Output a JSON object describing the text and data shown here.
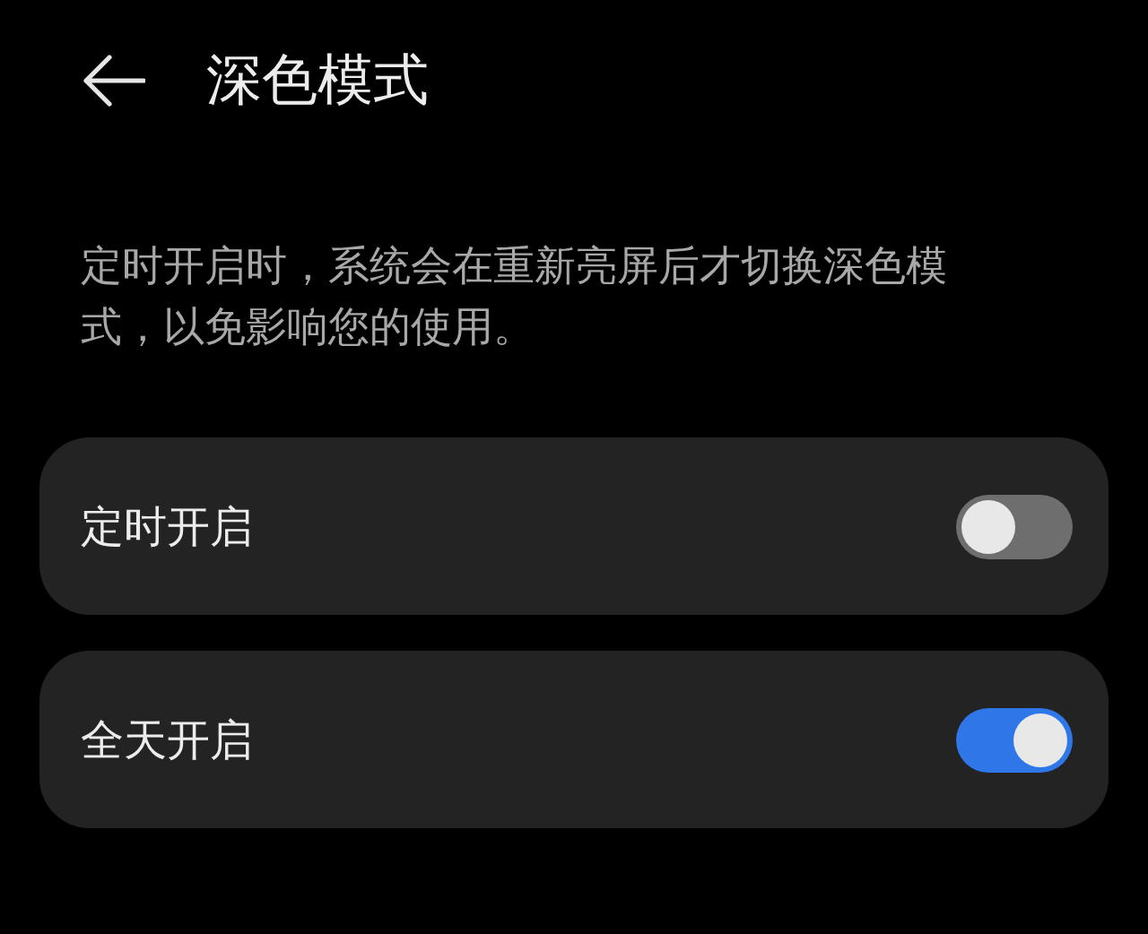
{
  "header": {
    "title": "深色模式"
  },
  "description": "定时开启时，系统会在重新亮屏后才切换深色模式，以免影响您的使用。",
  "options": [
    {
      "label": "定时开启",
      "on": false
    },
    {
      "label": "全天开启",
      "on": true
    }
  ]
}
